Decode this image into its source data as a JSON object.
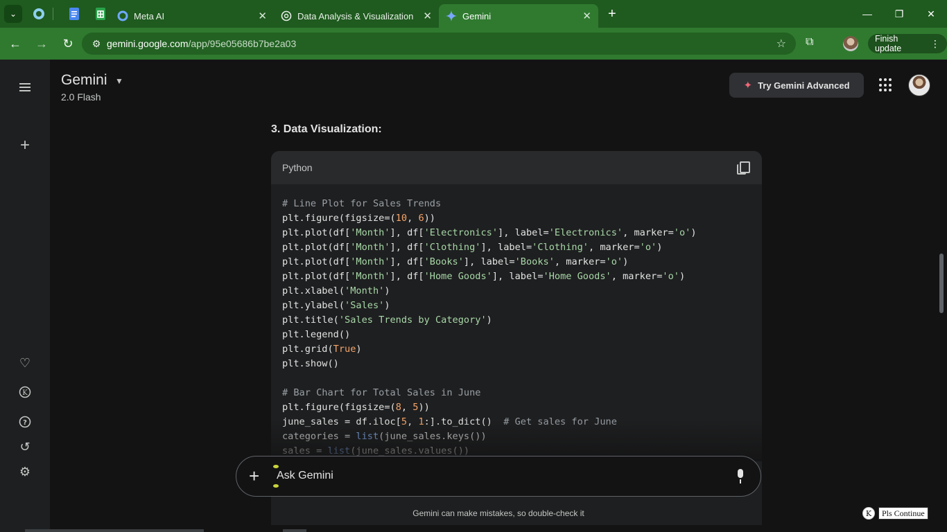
{
  "browser": {
    "tabs": [
      {
        "title": "Meta AI",
        "icon": "meta-ai-icon",
        "active": false
      },
      {
        "title": "Data Analysis & Visualization",
        "icon": "chatgpt-icon",
        "active": false
      },
      {
        "title": "Gemini",
        "icon": "gemini-icon",
        "active": true
      }
    ],
    "close_glyph": "✕",
    "new_tab_glyph": "+",
    "url_host": "gemini.google.com",
    "url_path": "/app/95e05686b7be2a03",
    "finish_update_label": "Finish update"
  },
  "app": {
    "title": "Gemini",
    "model": "2.0 Flash",
    "try_advanced_label": "Try Gemini Advanced"
  },
  "content": {
    "section_heading": "3. Data Visualization:",
    "code_language": "Python",
    "code_lines": [
      [
        {
          "t": "# Line Plot for Sales Trends",
          "c": "c"
        }
      ],
      [
        {
          "t": "plt.figure(figsize=("
        },
        {
          "t": "10",
          "c": "n"
        },
        {
          "t": ", "
        },
        {
          "t": "6",
          "c": "n"
        },
        {
          "t": "))"
        }
      ],
      [
        {
          "t": "plt.plot(df["
        },
        {
          "t": "'Month'",
          "c": "s"
        },
        {
          "t": "], df["
        },
        {
          "t": "'Electronics'",
          "c": "s"
        },
        {
          "t": "], label="
        },
        {
          "t": "'Electronics'",
          "c": "s"
        },
        {
          "t": ", marker="
        },
        {
          "t": "'o'",
          "c": "s"
        },
        {
          "t": ")"
        }
      ],
      [
        {
          "t": "plt.plot(df["
        },
        {
          "t": "'Month'",
          "c": "s"
        },
        {
          "t": "], df["
        },
        {
          "t": "'Clothing'",
          "c": "s"
        },
        {
          "t": "], label="
        },
        {
          "t": "'Clothing'",
          "c": "s"
        },
        {
          "t": ", marker="
        },
        {
          "t": "'o'",
          "c": "s"
        },
        {
          "t": ")"
        }
      ],
      [
        {
          "t": "plt.plot(df["
        },
        {
          "t": "'Month'",
          "c": "s"
        },
        {
          "t": "], df["
        },
        {
          "t": "'Books'",
          "c": "s"
        },
        {
          "t": "], label="
        },
        {
          "t": "'Books'",
          "c": "s"
        },
        {
          "t": ", marker="
        },
        {
          "t": "'o'",
          "c": "s"
        },
        {
          "t": ")"
        }
      ],
      [
        {
          "t": "plt.plot(df["
        },
        {
          "t": "'Month'",
          "c": "s"
        },
        {
          "t": "], df["
        },
        {
          "t": "'Home Goods'",
          "c": "s"
        },
        {
          "t": "], label="
        },
        {
          "t": "'Home Goods'",
          "c": "s"
        },
        {
          "t": ", marker="
        },
        {
          "t": "'o'",
          "c": "s"
        },
        {
          "t": ")"
        }
      ],
      [
        {
          "t": "plt.xlabel("
        },
        {
          "t": "'Month'",
          "c": "s"
        },
        {
          "t": ")"
        }
      ],
      [
        {
          "t": "plt.ylabel("
        },
        {
          "t": "'Sales'",
          "c": "s"
        },
        {
          "t": ")"
        }
      ],
      [
        {
          "t": "plt.title("
        },
        {
          "t": "'Sales Trends by Category'",
          "c": "s"
        },
        {
          "t": ")"
        }
      ],
      [
        {
          "t": "plt.legend()"
        }
      ],
      [
        {
          "t": "plt.grid("
        },
        {
          "t": "True",
          "c": "k"
        },
        {
          "t": ")"
        }
      ],
      [
        {
          "t": "plt.show()"
        }
      ],
      [],
      [
        {
          "t": "# Bar Chart for Total Sales in June",
          "c": "c"
        }
      ],
      [
        {
          "t": "plt.figure(figsize=("
        },
        {
          "t": "8",
          "c": "n"
        },
        {
          "t": ", "
        },
        {
          "t": "5",
          "c": "n"
        },
        {
          "t": "))"
        }
      ],
      [
        {
          "t": "june_sales = df.iloc["
        },
        {
          "t": "5",
          "c": "n"
        },
        {
          "t": ", "
        },
        {
          "t": "1",
          "c": "n"
        },
        {
          "t": ":].to_dict()  "
        },
        {
          "t": "# Get sales for June",
          "c": "c"
        }
      ],
      [
        {
          "t": "categories = "
        },
        {
          "t": "list",
          "c": "f"
        },
        {
          "t": "(june_sales.keys())"
        }
      ],
      [
        {
          "t": "sales = "
        },
        {
          "t": "list",
          "c": "f"
        },
        {
          "t": "(june_sales.values())"
        }
      ]
    ]
  },
  "prompt": {
    "placeholder": "Ask Gemini"
  },
  "footer": {
    "disclaimer": "Gemini can make mistakes, so double-check it",
    "badge_letter": "K",
    "pls_continue_label": "Pls Continue"
  },
  "colors": {
    "chrome_green": "#2f7a2f",
    "tabbar_green": "#1f5a1f",
    "app_bg": "#131314",
    "sidebar_bg": "#1e1f20",
    "code_string": "#a8d8a8",
    "code_number": "#f5a56a",
    "code_comment": "#9aa0a6"
  }
}
